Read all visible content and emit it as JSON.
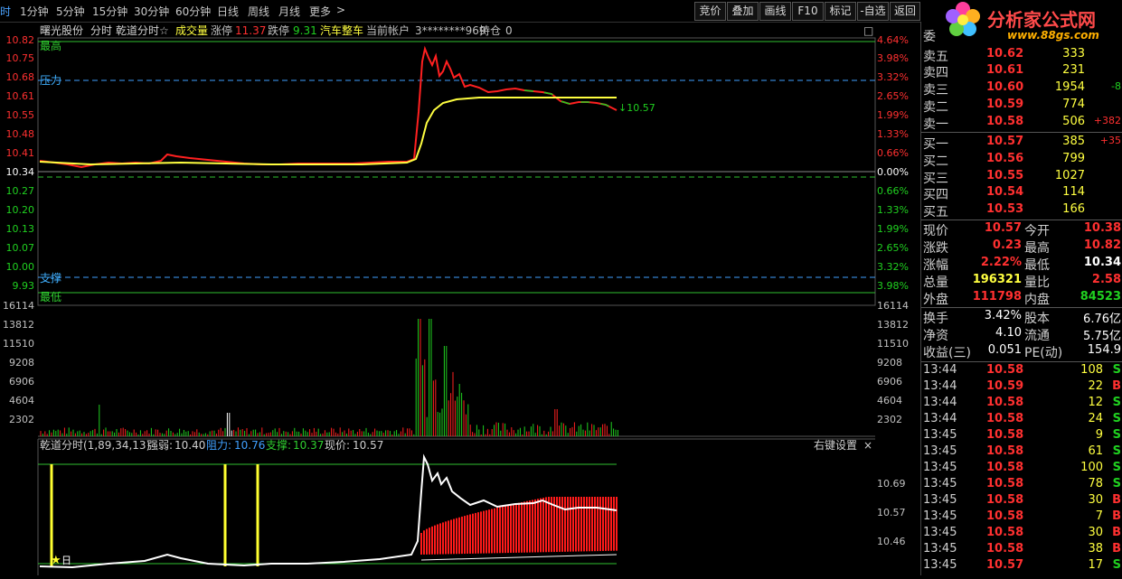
{
  "toolbar": {
    "tabs": [
      "时",
      "1分钟",
      "5分钟",
      "15分钟",
      "30分钟",
      "60分钟",
      "日线",
      "周线",
      "月线",
      "更多"
    ],
    "more_arrow": ">",
    "right_buttons": [
      "竞价",
      "叠加",
      "画线",
      "F10",
      "标记",
      "-自选",
      "返回"
    ]
  },
  "logo": {
    "text": "分析家公式网",
    "url": "www.88gs.com"
  },
  "info_bar": {
    "stock_name": "曙光股份",
    "mode": "分时",
    "indicator": "乾道分时☆",
    "volume_label": "成交量",
    "limit_up_label": "涨停",
    "limit_up": "11.37",
    "limit_down_label": "跌停",
    "limit_down": "9.31",
    "sector": "汽车整车",
    "account_label": "当前帐户",
    "account": "3********969",
    "position_label": "持仓",
    "position": "0",
    "close_icon": "□"
  },
  "price_chart": {
    "left_labels": [
      "10.82",
      "10.75",
      "10.68",
      "10.61",
      "10.55",
      "10.48",
      "10.41",
      "10.34",
      "10.27",
      "10.20",
      "10.13",
      "10.07",
      "10.00",
      "9.93"
    ],
    "right_labels": [
      "4.64%",
      "3.98%",
      "3.32%",
      "2.65%",
      "1.99%",
      "1.33%",
      "0.66%",
      "0.00%",
      "0.66%",
      "1.33%",
      "1.99%",
      "2.65%",
      "3.32%",
      "3.98%"
    ],
    "high_label": "最高",
    "resistance_label": "压力",
    "support_label": "支撑",
    "low_label": "最低",
    "last_label": "↓10.57",
    "top_partial_label": "0",
    "colors": {
      "up": "#ff2020",
      "down": "#20d020",
      "avg": "#ffff40"
    }
  },
  "volume_chart": {
    "left_labels": [
      "16114",
      "13812",
      "11510",
      "9208",
      "6906",
      "4604",
      "2302"
    ],
    "right_labels": [
      "16114",
      "13812",
      "11510",
      "9208",
      "6906",
      "4604",
      "2302"
    ]
  },
  "indicator_chart": {
    "title": "乾道分时(1,89,34,13)",
    "strength_label": "强弱:",
    "strength": "10.40",
    "resistance_label": "阻力:",
    "resistance": "10.76",
    "support_label": "支撑:",
    "support": "10.37",
    "price_label": "现价:",
    "price": "10.57",
    "settings": "右键设置",
    "close": "×",
    "right_labels": [
      "10.69",
      "10.57",
      "10.46"
    ],
    "star_marker": "★",
    "star_text": "日"
  },
  "order_book": {
    "title": "委",
    "sells": [
      {
        "label": "卖五",
        "price": "10.62",
        "vol": "333",
        "chg": ""
      },
      {
        "label": "卖四",
        "price": "10.61",
        "vol": "231",
        "chg": ""
      },
      {
        "label": "卖三",
        "price": "10.60",
        "vol": "1954",
        "chg": "-8"
      },
      {
        "label": "卖二",
        "price": "10.59",
        "vol": "774",
        "chg": ""
      },
      {
        "label": "卖一",
        "price": "10.58",
        "vol": "506",
        "chg": "+382"
      }
    ],
    "buys": [
      {
        "label": "买一",
        "price": "10.57",
        "vol": "385",
        "chg": "+35"
      },
      {
        "label": "买二",
        "price": "10.56",
        "vol": "799",
        "chg": ""
      },
      {
        "label": "买三",
        "price": "10.55",
        "vol": "1027",
        "chg": ""
      },
      {
        "label": "买四",
        "price": "10.54",
        "vol": "114",
        "chg": ""
      },
      {
        "label": "买五",
        "price": "10.53",
        "vol": "166",
        "chg": ""
      }
    ]
  },
  "quote": [
    {
      "l1": "现价",
      "v1": "10.57",
      "c1": "#ff3030",
      "l2": "今开",
      "v2": "10.38",
      "c2": "#ff3030"
    },
    {
      "l1": "涨跌",
      "v1": "0.23",
      "c1": "#ff3030",
      "l2": "最高",
      "v2": "10.82",
      "c2": "#ff3030"
    },
    {
      "l1": "涨幅",
      "v1": "2.22%",
      "c1": "#ff3030",
      "l2": "最低",
      "v2": "10.34",
      "c2": "#ffffff"
    },
    {
      "l1": "总量",
      "v1": "196321",
      "c1": "#ffff40",
      "l2": "量比",
      "v2": "2.58",
      "c2": "#ff3030"
    },
    {
      "l1": "外盘",
      "v1": "111798",
      "c1": "#ff3030",
      "l2": "内盘",
      "v2": "84523",
      "c2": "#20d020"
    }
  ],
  "fundamentals": [
    {
      "l1": "换手",
      "v1": "3.42%",
      "l2": "股本",
      "v2": "6.76亿"
    },
    {
      "l1": "净资",
      "v1": "4.10",
      "l2": "流通",
      "v2": "5.75亿"
    },
    {
      "l1": "收益(三)",
      "v1": "0.051",
      "l2": "PE(动)",
      "v2": "154.9"
    }
  ],
  "ticks": [
    {
      "time": "13:44",
      "price": "10.58",
      "vol": "108",
      "side": "S"
    },
    {
      "time": "13:44",
      "price": "10.59",
      "vol": "22",
      "side": "B"
    },
    {
      "time": "13:44",
      "price": "10.58",
      "vol": "12",
      "side": "S"
    },
    {
      "time": "13:44",
      "price": "10.58",
      "vol": "24",
      "side": "S"
    },
    {
      "time": "13:45",
      "price": "10.58",
      "vol": "9",
      "side": "S"
    },
    {
      "time": "13:45",
      "price": "10.58",
      "vol": "61",
      "side": "S"
    },
    {
      "time": "13:45",
      "price": "10.58",
      "vol": "100",
      "side": "S"
    },
    {
      "time": "13:45",
      "price": "10.58",
      "vol": "78",
      "side": "S"
    },
    {
      "time": "13:45",
      "price": "10.58",
      "vol": "30",
      "side": "B"
    },
    {
      "time": "13:45",
      "price": "10.58",
      "vol": "7",
      "side": "B"
    },
    {
      "time": "13:45",
      "price": "10.58",
      "vol": "30",
      "side": "B"
    },
    {
      "time": "13:45",
      "price": "10.58",
      "vol": "38",
      "side": "B"
    },
    {
      "time": "13:45",
      "price": "10.57",
      "vol": "17",
      "side": "S"
    }
  ]
}
